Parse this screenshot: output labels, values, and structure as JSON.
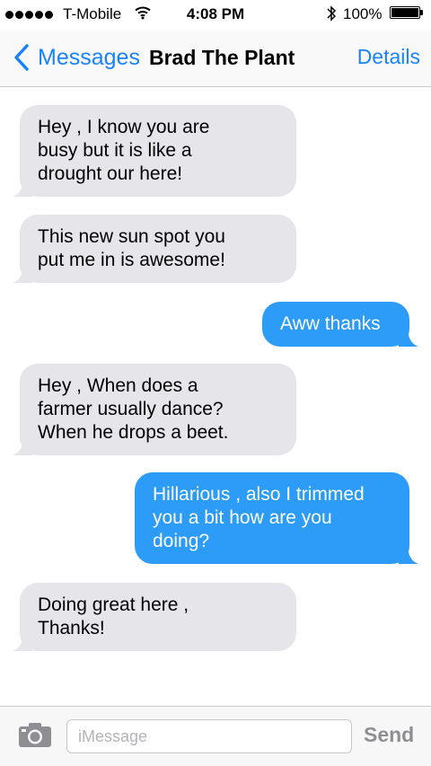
{
  "status_bar": {
    "carrier": "T-Mobile",
    "time": "4:08 PM",
    "battery": "100%",
    "icons": [
      "signal-dots",
      "wifi-icon",
      "bluetooth-icon",
      "battery-icon"
    ]
  },
  "nav": {
    "back_label": "Messages",
    "title": "Brad The Plant",
    "details_label": "Details"
  },
  "messages": [
    {
      "direction": "incoming",
      "text": "Hey , I know you are\nbusy but it is like a\ndrought our here!"
    },
    {
      "direction": "incoming",
      "text": "This new sun spot you\nput me in is awesome!"
    },
    {
      "direction": "outgoing",
      "text": "Aww thanks"
    },
    {
      "direction": "incoming",
      "text": "Hey , When does a\nfarmer usually dance?\nWhen he drops a beet."
    },
    {
      "direction": "outgoing",
      "text": "Hillarious , also I trimmed\nyou a bit how are you\ndoing?"
    },
    {
      "direction": "incoming",
      "text": "Doing great here ,\nThanks!"
    }
  ],
  "input_bar": {
    "placeholder": "iMessage",
    "send_label": "Send",
    "camera_icon": "camera-icon"
  },
  "colors": {
    "accent": "#1a82fb",
    "outgoing_bubble": "#2d9bf8",
    "incoming_bubble": "#e5e5ea",
    "send_disabled": "#8e8e93"
  }
}
